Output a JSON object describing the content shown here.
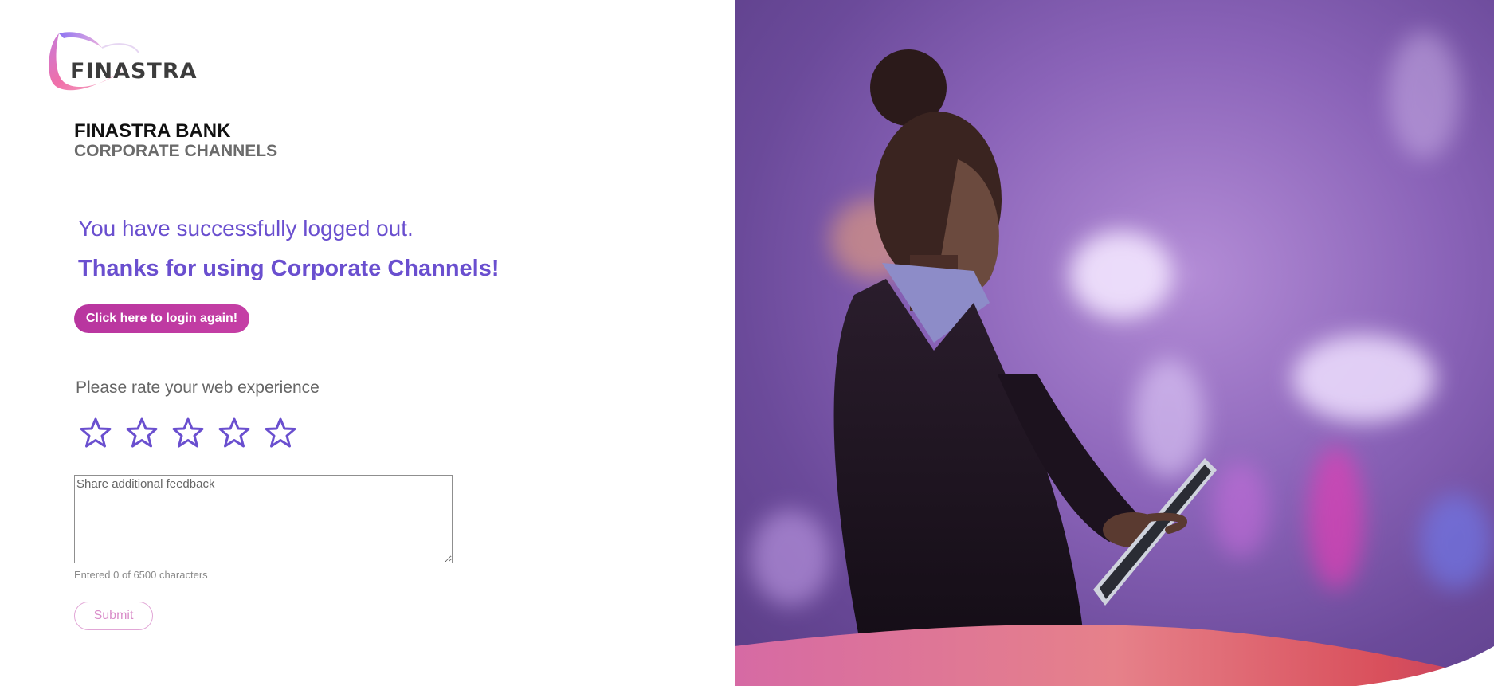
{
  "brand": {
    "logo_text": "FINASTRA",
    "bank_name": "FINASTRA BANK",
    "bank_subtitle": "CORPORATE CHANNELS"
  },
  "logout": {
    "message": "You have successfully logged out.",
    "thanks": "Thanks for using Corporate Channels!",
    "login_again_label": "Click here to login again!"
  },
  "rating": {
    "label": "Please rate your web experience",
    "max_stars": 5,
    "selected_stars": 0,
    "star_color": "#6a4fcf"
  },
  "feedback": {
    "placeholder": "Share additional feedback",
    "value": "",
    "char_count_text": "Entered 0 of 6500 characters"
  },
  "actions": {
    "submit_label": "Submit"
  },
  "colors": {
    "accent_purple": "#6a4fcf",
    "button_magenta": "#b8359f",
    "submit_border": "#e1a6d6"
  }
}
